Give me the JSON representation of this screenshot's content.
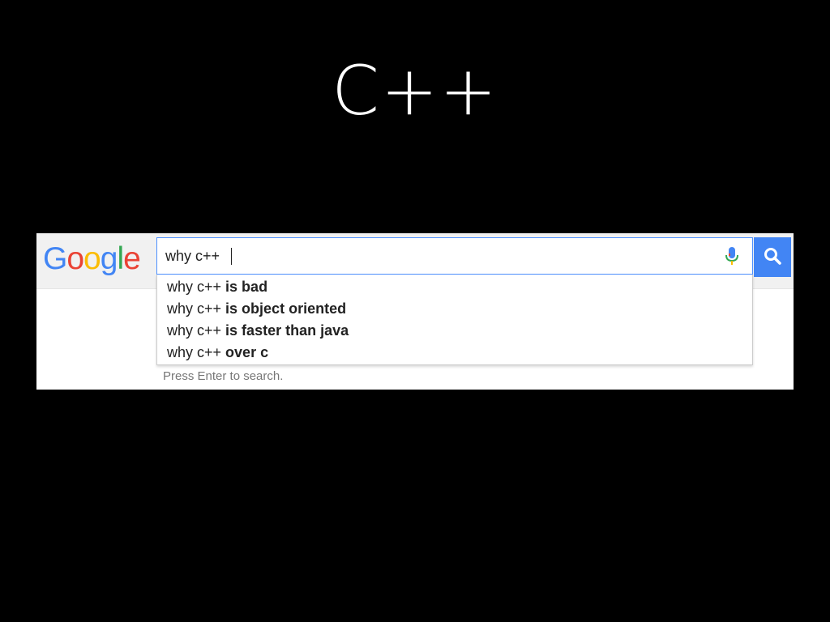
{
  "slide": {
    "title": "C++"
  },
  "logo": {
    "letters": [
      "G",
      "o",
      "o",
      "g",
      "l",
      "e"
    ]
  },
  "search": {
    "value": "why c++ "
  },
  "suggestions": [
    {
      "prefix": "why c++ ",
      "completion": "is bad"
    },
    {
      "prefix": "why c++ ",
      "completion": "is object oriented"
    },
    {
      "prefix": "why c++ ",
      "completion": "is faster than java"
    },
    {
      "prefix": "why c++ ",
      "completion": "over c"
    }
  ],
  "hint": "Press Enter to search.",
  "icons": {
    "mic": "microphone-icon",
    "search": "magnifier-icon"
  },
  "colors": {
    "search_button": "#4285f4",
    "focus_border": "#4d90fe",
    "logo": [
      "#4285f4",
      "#ea4335",
      "#fbbc05",
      "#4285f4",
      "#34a853",
      "#ea4335"
    ]
  }
}
